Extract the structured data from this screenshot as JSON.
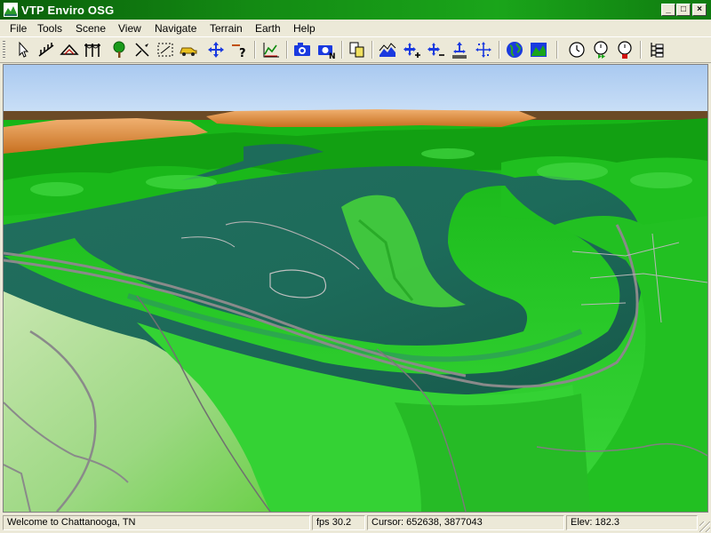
{
  "window": {
    "title": "VTP Enviro OSG"
  },
  "menu": [
    "File",
    "Tools",
    "Scene",
    "View",
    "Navigate",
    "Terrain",
    "Earth",
    "Help"
  ],
  "toolbar": [
    {
      "name": "select-tool-button",
      "icon": "cursor-arrow-icon"
    },
    {
      "name": "fence-tool-button",
      "icon": "fence-icon"
    },
    {
      "name": "route-tool-button",
      "icon": "route-icon"
    },
    {
      "name": "powerline-tool-button",
      "icon": "powerline-icon"
    },
    {
      "name": "plant-tool-button",
      "icon": "tree-icon"
    },
    {
      "name": "measure-tool-button",
      "icon": "measure-icon"
    },
    {
      "name": "box-select-tool-button",
      "icon": "box-select-icon"
    },
    {
      "name": "vehicle-tool-button",
      "icon": "vehicle-icon"
    },
    {
      "name": "move-tool-button",
      "icon": "move-arrows-icon"
    },
    {
      "name": "instance-tool-button",
      "icon": "instance-question-icon"
    },
    {
      "name": "profile-tool-button",
      "icon": "profile-graph-icon"
    },
    {
      "name": "snapshot-button",
      "icon": "camera-icon"
    },
    {
      "name": "snapshot-numbered-button",
      "icon": "camera-numbered-icon"
    },
    {
      "name": "layers-button",
      "icon": "layers-icon"
    },
    {
      "name": "maintain-height-button",
      "icon": "terrain-follow-icon"
    },
    {
      "name": "faster-button",
      "icon": "speed-up-icon"
    },
    {
      "name": "slower-button",
      "icon": "slow-down-icon"
    },
    {
      "name": "ground-button",
      "icon": "ground-anchor-icon"
    },
    {
      "name": "fly-nav-button",
      "icon": "fly-arrows-icon"
    },
    {
      "name": "earth-view-button",
      "icon": "globe-icon"
    },
    {
      "name": "terrain-view-button",
      "icon": "terrain-map-icon"
    },
    {
      "name": "time-button",
      "icon": "clock-icon"
    },
    {
      "name": "time-play-button",
      "icon": "clock-play-icon"
    },
    {
      "name": "time-stop-button",
      "icon": "clock-stop-icon"
    },
    {
      "name": "scene-graph-button",
      "icon": "scene-graph-icon"
    }
  ],
  "status": {
    "message": "Welcome to Chattanooga, TN",
    "fps": "fps 30.2",
    "cursor": "Cursor: 652638, 3877043",
    "elev": "Elev: 182.3"
  },
  "colors": {
    "title_bar": "#138a13",
    "sky": "#b5d3f2",
    "river": "#1d6b5a",
    "terrain_green": "#2fcf2f",
    "ridge": "#e8a050"
  }
}
